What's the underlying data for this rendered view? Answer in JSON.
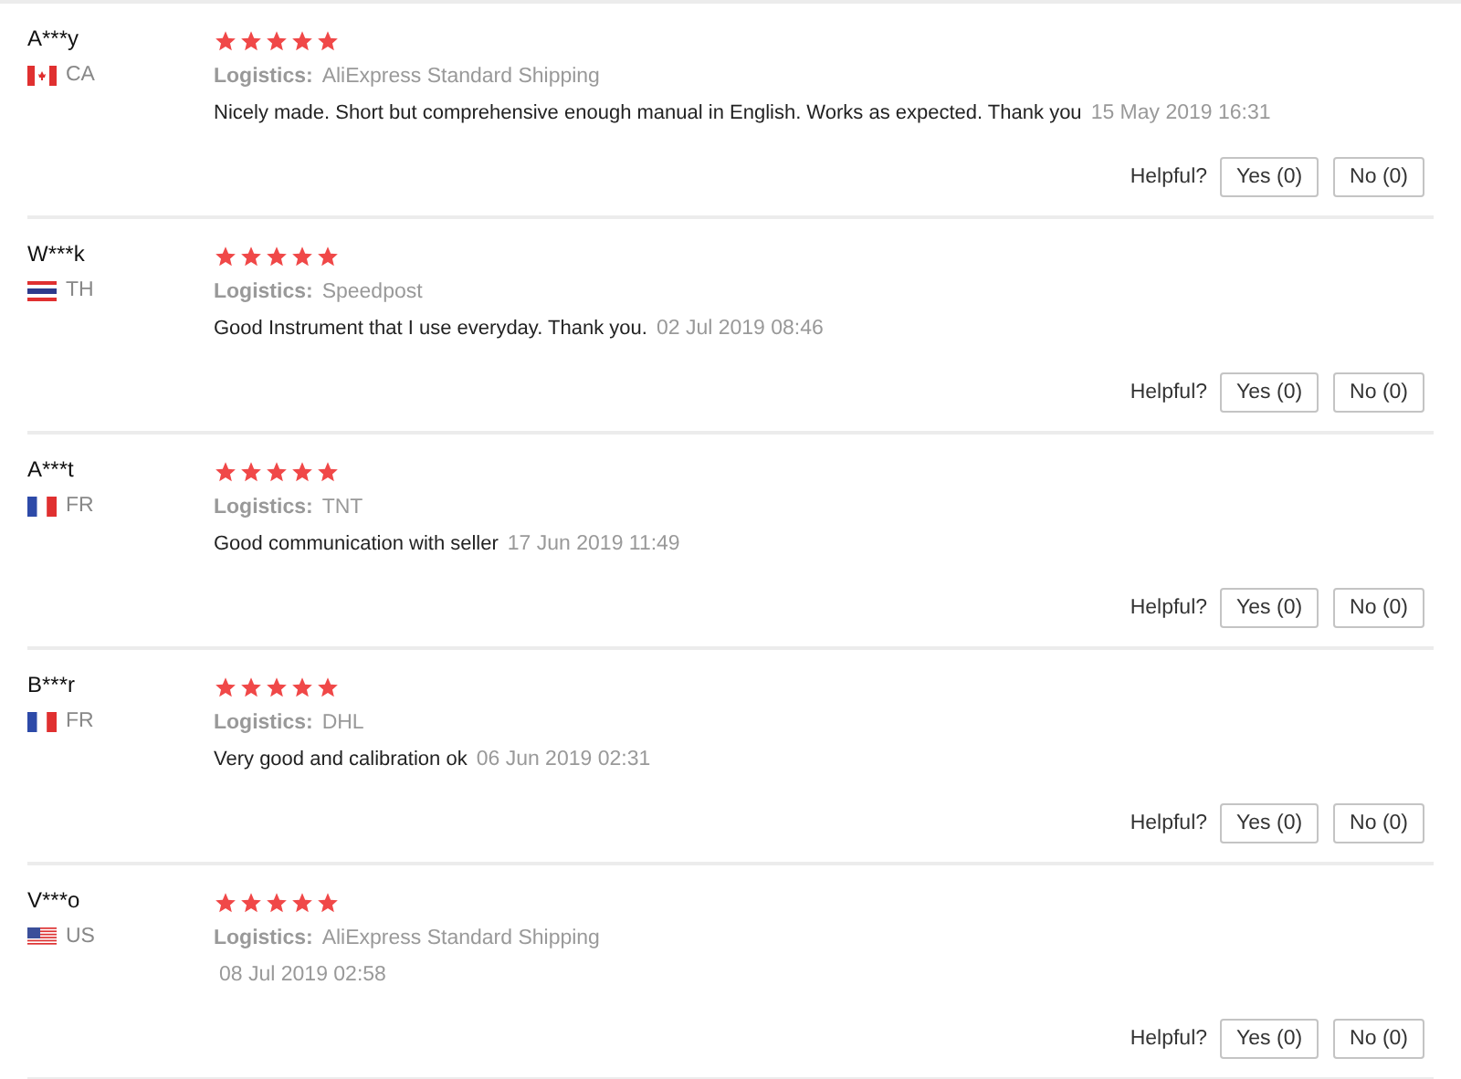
{
  "reviews": [
    {
      "name": "A***y",
      "kind": "ca",
      "country": "CA",
      "stars": 5,
      "logistics_label": "Logistics:",
      "logistics": "AliExpress Standard Shipping",
      "text": "Nicely made. Short but comprehensive enough manual in English. Works as expected. Thank you",
      "date": "15 May 2019 16:31",
      "helpful": "Helpful?",
      "yes": "Yes (0)",
      "no": "No (0)"
    },
    {
      "name": "W***k",
      "kind": "th",
      "country": "TH",
      "stars": 5,
      "logistics_label": "Logistics:",
      "logistics": "Speedpost",
      "text": "Good Instrument that I use everyday. Thank you.",
      "date": "02 Jul 2019 08:46",
      "helpful": "Helpful?",
      "yes": "Yes (0)",
      "no": "No (0)"
    },
    {
      "name": "A***t",
      "kind": "fr",
      "country": "FR",
      "stars": 5,
      "logistics_label": "Logistics:",
      "logistics": "TNT",
      "text": "Good communication with seller",
      "date": "17 Jun 2019 11:49",
      "helpful": "Helpful?",
      "yes": "Yes (0)",
      "no": "No (0)"
    },
    {
      "name": "B***r",
      "kind": "fr",
      "country": "FR",
      "stars": 5,
      "logistics_label": "Logistics:",
      "logistics": "DHL",
      "text": "Very good and calibration ok",
      "date": "06 Jun 2019 02:31",
      "helpful": "Helpful?",
      "yes": "Yes (0)",
      "no": "No (0)"
    },
    {
      "name": "V***o",
      "kind": "us",
      "country": "US",
      "stars": 5,
      "logistics_label": "Logistics:",
      "logistics": "AliExpress Standard Shipping",
      "date": "08 Jul 2019 02:58",
      "helpful": "Helpful?",
      "yes": "Yes (0)",
      "no": "No (0)"
    }
  ]
}
